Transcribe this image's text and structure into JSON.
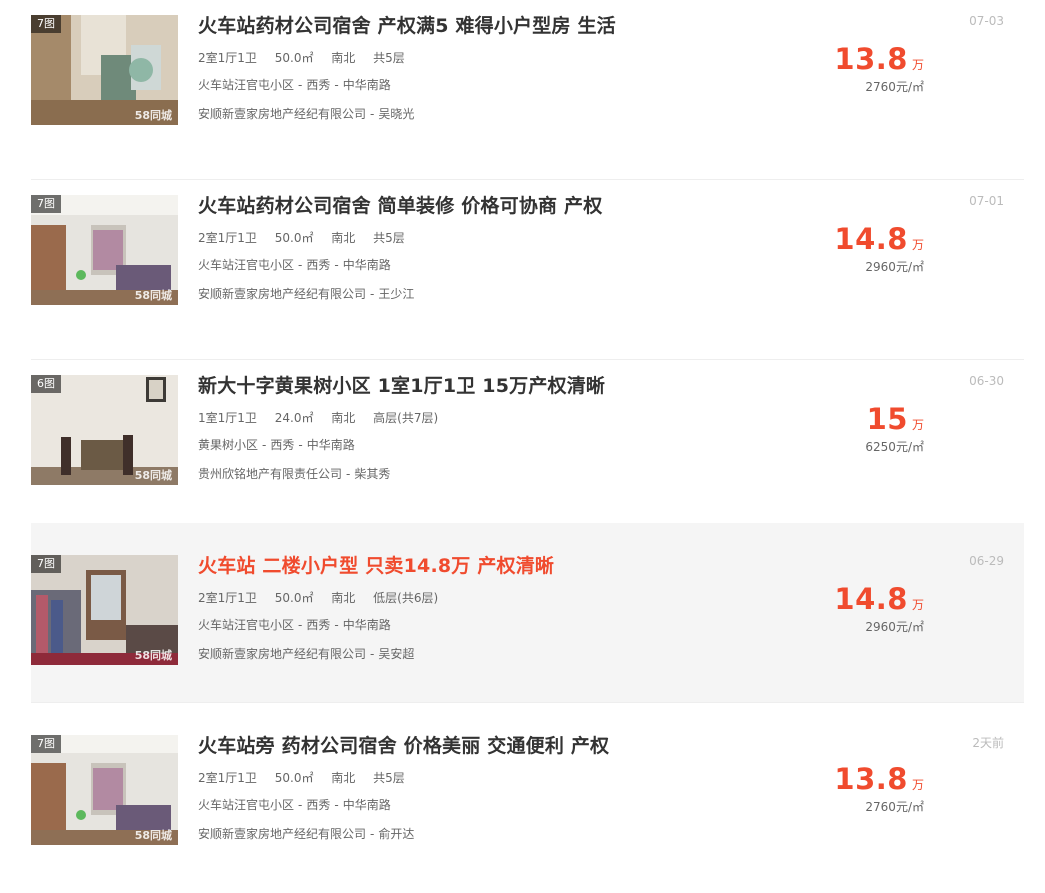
{
  "listings": [
    {
      "photo_count": "7图",
      "title": "火车站药材公司宿舍 产权满5 难得小户型房 生活",
      "layout": "2室1厅1卫",
      "area": "50.0㎡",
      "orientation": "南北",
      "floor": "共5层",
      "community": "火车站汪官屯小区",
      "district": "西秀",
      "road": "中华南路",
      "company": "安顺新壹家房地产经纪有限公司",
      "agent": "吴晓光",
      "price": "13.8",
      "price_unit": "万",
      "unit_price": "2760元/㎡",
      "date": "07-03",
      "watermark": "58同城",
      "highlighted": false
    },
    {
      "photo_count": "7图",
      "title": "火车站药材公司宿舍 简单装修 价格可协商 产权",
      "layout": "2室1厅1卫",
      "area": "50.0㎡",
      "orientation": "南北",
      "floor": "共5层",
      "community": "火车站汪官屯小区",
      "district": "西秀",
      "road": "中华南路",
      "company": "安顺新壹家房地产经纪有限公司",
      "agent": "王少江",
      "price": "14.8",
      "price_unit": "万",
      "unit_price": "2960元/㎡",
      "date": "07-01",
      "watermark": "58同城",
      "highlighted": false
    },
    {
      "photo_count": "6图",
      "title": "新大十字黄果树小区 1室1厅1卫 15万产权清晰",
      "layout": "1室1厅1卫",
      "area": "24.0㎡",
      "orientation": "南北",
      "floor": "高层(共7层)",
      "community": "黄果树小区",
      "district": "西秀",
      "road": "中华南路",
      "company": "贵州欣铭地产有限责任公司",
      "agent": "柴其秀",
      "price": "15",
      "price_unit": "万",
      "unit_price": "6250元/㎡",
      "date": "06-30",
      "watermark": "58同城",
      "highlighted": false
    },
    {
      "photo_count": "7图",
      "title": "火车站 二楼小户型 只卖14.8万 产权清晰",
      "layout": "2室1厅1卫",
      "area": "50.0㎡",
      "orientation": "南北",
      "floor": "低层(共6层)",
      "community": "火车站汪官屯小区",
      "district": "西秀",
      "road": "中华南路",
      "company": "安顺新壹家房地产经纪有限公司",
      "agent": "吴安超",
      "price": "14.8",
      "price_unit": "万",
      "unit_price": "2960元/㎡",
      "date": "06-29",
      "watermark": "58同城",
      "highlighted": true
    },
    {
      "photo_count": "7图",
      "title": "火车站旁 药材公司宿舍 价格美丽 交通便利 产权",
      "layout": "2室1厅1卫",
      "area": "50.0㎡",
      "orientation": "南北",
      "floor": "共5层",
      "community": "火车站汪官屯小区",
      "district": "西秀",
      "road": "中华南路",
      "company": "安顺新壹家房地产经纪有限公司",
      "agent": "俞开达",
      "price": "13.8",
      "price_unit": "万",
      "unit_price": "2760元/㎡",
      "date": "2天前",
      "watermark": "58同城",
      "highlighted": false
    }
  ],
  "separator": "-",
  "colors": {
    "accent": "#f04b2e",
    "text": "#333333",
    "muted": "#666666",
    "date": "#bbbbbb",
    "highlight_bg": "#f5f5f5"
  }
}
